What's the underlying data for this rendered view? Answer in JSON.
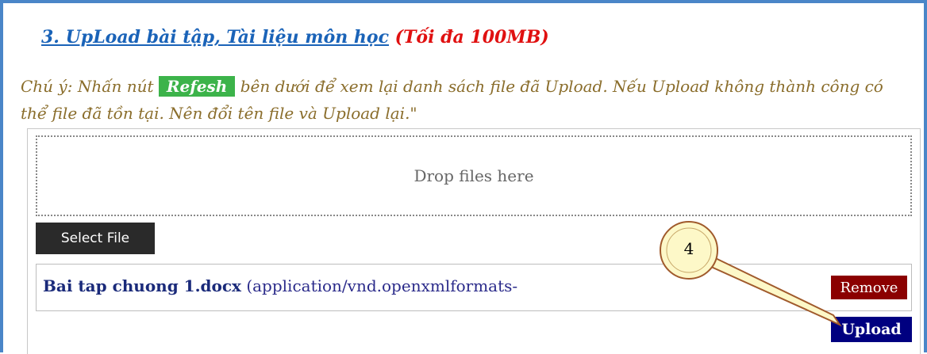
{
  "section": {
    "title_link": "3. UpLoad bài tập, Tài liệu môn học",
    "size_limit": "(Tối đa 100MB)"
  },
  "note": {
    "prefix": "Chú ý: Nhấn nút ",
    "refresh_label": "Refesh",
    "suffix": " bên dưới để xem lại danh sách file đã Upload. Nếu Upload không thành công có thể file đã tồn tại. Nên đổi tên file và Upload lại.\""
  },
  "dropzone": {
    "label": "Drop files here"
  },
  "buttons": {
    "select_file": "Select File",
    "remove": "Remove",
    "upload": "Upload"
  },
  "file": {
    "name": "Bai tap chuong 1.docx",
    "type": "(application/vnd.openxmlformats-"
  },
  "callout": {
    "number": "4"
  },
  "colors": {
    "frame_border": "#4a86c8",
    "link": "#1a63b8",
    "limit": "#e01010",
    "note": "#8a6d2b",
    "refresh_badge": "#3cb34a",
    "remove_button": "#8b0000",
    "upload_button": "#000080",
    "callout_fill": "#fdf8c8",
    "callout_stroke": "#a05a2c"
  }
}
